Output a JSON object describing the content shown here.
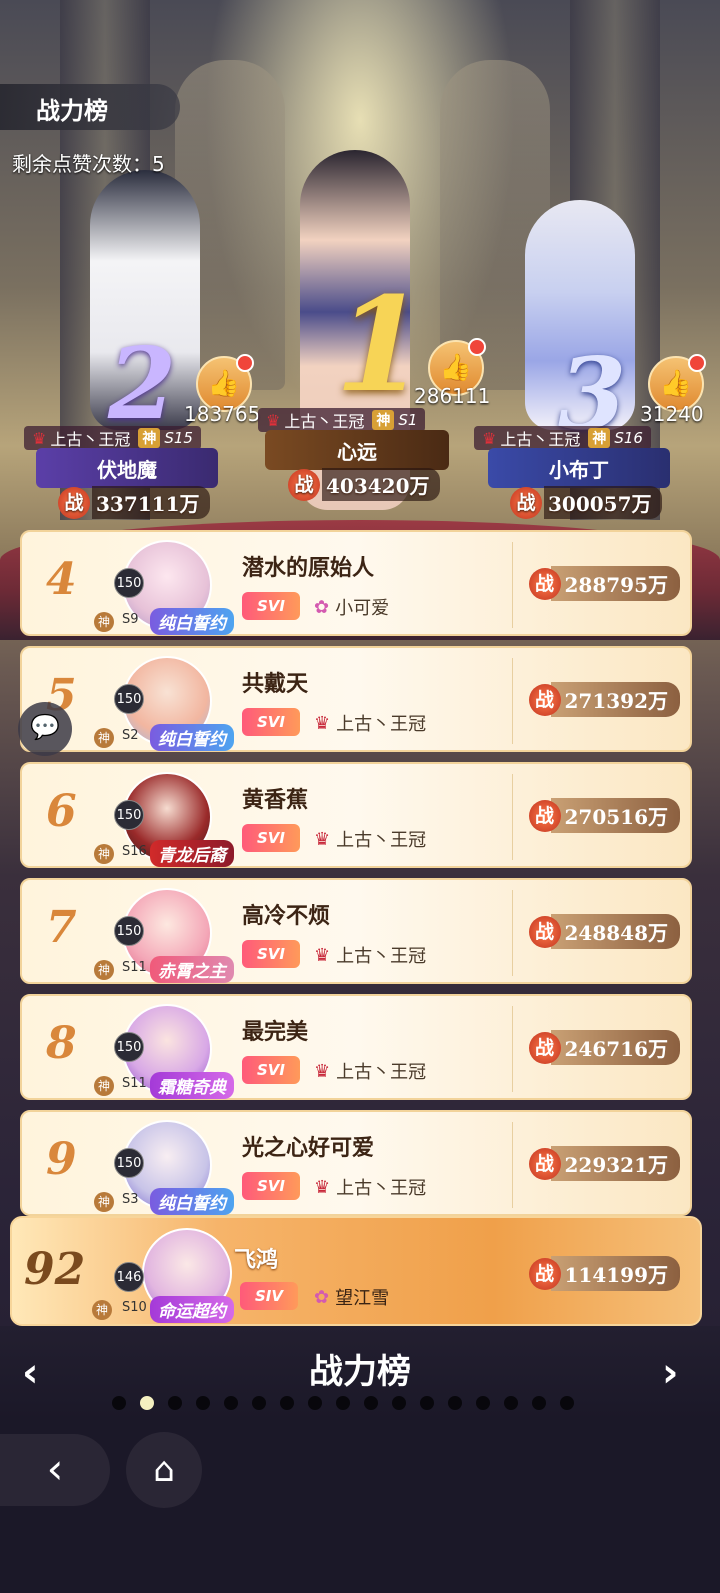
{
  "header": {
    "title": "战力榜",
    "likes_remaining": "剩余点赞次数：5"
  },
  "podium": [
    {
      "rank": "2",
      "like_count": "183765",
      "guild": "上古丶王冠",
      "god": "神",
      "season": "S15",
      "name": "伏地魔",
      "power_label": "战",
      "power": "337111万"
    },
    {
      "rank": "1",
      "like_count": "286111",
      "guild": "上古丶王冠",
      "god": "神",
      "season": "S1",
      "name": "心远",
      "power_label": "战",
      "power": "403420万"
    },
    {
      "rank": "3",
      "like_count": "31240",
      "guild": "上古丶王冠",
      "god": "神",
      "season": "S16",
      "name": "小布丁",
      "power_label": "战",
      "power": "300057万"
    }
  ],
  "rows": [
    {
      "rank": "4",
      "level": "150",
      "god": "神",
      "season": "S9",
      "frame": "纯白誓约",
      "name": "潜水的原始人",
      "vip": "SVI",
      "guild": "小可爱",
      "power_label": "战",
      "power": "288795万"
    },
    {
      "rank": "5",
      "level": "150",
      "god": "神",
      "season": "S2",
      "frame": "纯白誓约",
      "name": "共戴天",
      "vip": "SVI",
      "guild": "上古丶王冠",
      "power_label": "战",
      "power": "271392万"
    },
    {
      "rank": "6",
      "level": "150",
      "god": "神",
      "season": "S16",
      "frame": "青龙后裔",
      "name": "黄香蕉",
      "vip": "SVI",
      "guild": "上古丶王冠",
      "power_label": "战",
      "power": "270516万"
    },
    {
      "rank": "7",
      "level": "150",
      "god": "神",
      "season": "S11",
      "frame": "赤霄之主",
      "name": "高冷不烦",
      "vip": "SVI",
      "guild": "上古丶王冠",
      "power_label": "战",
      "power": "248848万"
    },
    {
      "rank": "8",
      "level": "150",
      "god": "神",
      "season": "S11",
      "frame": "霜糖奇典",
      "name": "最完美",
      "vip": "SVI",
      "guild": "上古丶王冠",
      "power_label": "战",
      "power": "246716万"
    },
    {
      "rank": "9",
      "level": "150",
      "god": "神",
      "season": "S3",
      "frame": "纯白誓约",
      "name": "光之心好可爱",
      "vip": "SVI",
      "guild": "上古丶王冠",
      "power_label": "战",
      "power": "229321万"
    }
  ],
  "self": {
    "rank": "92",
    "level": "146",
    "god": "神",
    "season": "S10",
    "frame": "命运超约",
    "name": "飞鸿",
    "vip": "SIV",
    "guild": "望江雪",
    "power_label": "战",
    "power": "114199万"
  },
  "pager": {
    "title": "战力榜",
    "prev": "‹",
    "next": "›",
    "page_count": 17,
    "active_index": 1
  },
  "nav": {
    "back": "‹",
    "home": "⌂"
  },
  "colors": {
    "accent": "#d9873b",
    "power_badge": "#c0331f",
    "active_dot": "#f4f0c0"
  }
}
